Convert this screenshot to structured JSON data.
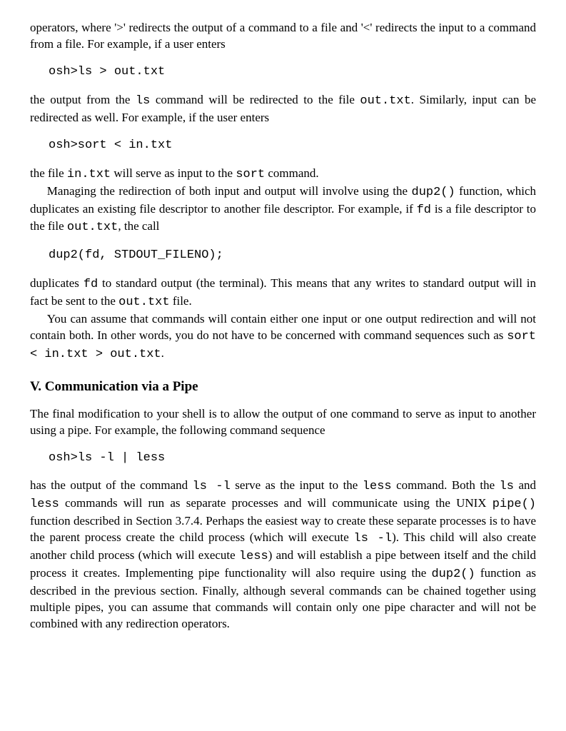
{
  "p1_a": "operators, where '>' redirects the output of a command to a file and '<' redirects the input to a command from a file. For example, if a user enters",
  "code1": "osh>ls > out.txt",
  "p2_a": "the output from the ",
  "p2_b": "ls",
  "p2_c": " command will be redirected to the file ",
  "p2_d": "out.txt",
  "p2_e": ". Similarly, input can be redirected as well. For example, if the user enters",
  "code2": "osh>sort < in.txt",
  "p3_a": "the file ",
  "p3_b": "in.txt",
  "p3_c": " will serve as input to the ",
  "p3_d": "sort",
  "p3_e": " command.",
  "p4_a": "Managing the redirection of both input and output will involve using the ",
  "p4_b": "dup2()",
  "p4_c": " function, which duplicates an existing file descriptor to another file descriptor. For example, if ",
  "p4_d": "fd",
  "p4_e": " is a file descriptor to the file ",
  "p4_f": "out.txt",
  "p4_g": ", the call",
  "code3": "dup2(fd, STDOUT_FILENO);",
  "p5_a": "duplicates ",
  "p5_b": "fd",
  "p5_c": " to standard output (the terminal). This means that any writes to standard output will in fact be sent to the ",
  "p5_d": "out.txt",
  "p5_e": " file.",
  "p6_a": "You can assume that commands will contain either one input or one output redirection and will not contain both. In other words, you do not have to be concerned with command sequences such as ",
  "p6_b": "sort < in.txt > out.txt",
  "p6_c": ".",
  "heading": "V. Communication via a Pipe",
  "p7_a": "The final modification to your shell is to allow the output of one command to serve as input to another using a pipe. For example, the following command sequence",
  "code4": "osh>ls -l | less",
  "p8_a": "has the output of the command ",
  "p8_b": "ls -l",
  "p8_c": " serve as the input to the ",
  "p8_d": "less",
  "p8_e": " command. Both the ",
  "p8_f": "ls",
  "p8_g": " and ",
  "p8_h": "less",
  "p8_i": " commands will run as separate processes and will communicate using the ",
  "p8_j": "UNIX",
  "p8_k": " ",
  "p8_l": "pipe()",
  "p8_m": " function described in Section 3.7.4. Perhaps the easiest way to create these separate processes is to have the parent process create the child process (which will execute ",
  "p8_n": "ls -l",
  "p8_o": "). This child will also create another child process (which will execute ",
  "p8_p": "less",
  "p8_q": ") and will establish a pipe between itself and the child process it creates. Implementing pipe functionality will also require using the ",
  "p8_r": "dup2()",
  "p8_s": " function as described in the previous section. Finally, although several commands can be chained together using multiple pipes, you can assume that commands will contain only one pipe character and will not be combined with any redirection operators."
}
